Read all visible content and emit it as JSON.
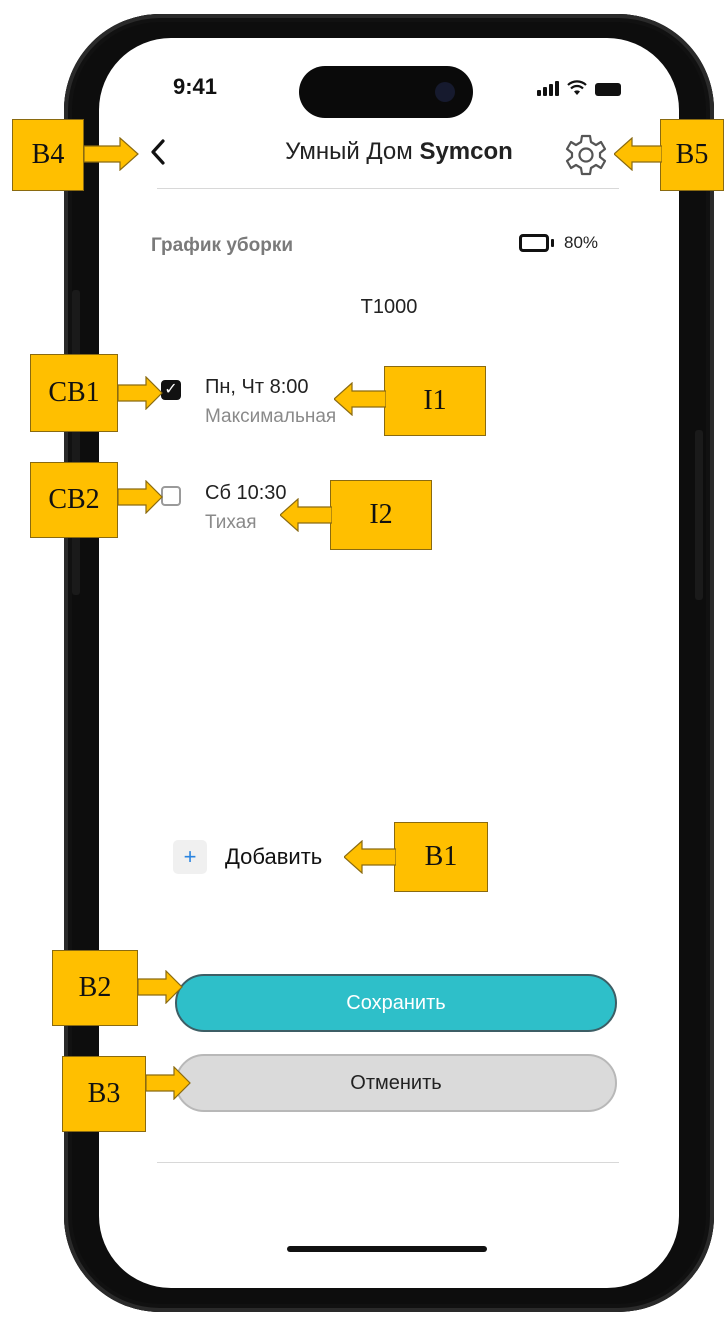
{
  "status_bar": {
    "time": "9:41"
  },
  "nav": {
    "back_icon": "chevron-left-icon",
    "title_regular": "Умный Дом ",
    "title_bold": "Symcon",
    "settings_icon": "gear-icon"
  },
  "section": {
    "title": "График уборки"
  },
  "battery": {
    "icon": "battery-icon",
    "level_text": "80%"
  },
  "device": {
    "name": "T1000"
  },
  "schedules": [
    {
      "time": "Пн, Чт 8:00",
      "mode": "Максимальная",
      "checked": true
    },
    {
      "time": "Сб 10:30",
      "mode": "Тихая",
      "checked": false
    }
  ],
  "add": {
    "icon": "plus-icon",
    "label": "Добавить"
  },
  "buttons": {
    "save": "Сохранить",
    "cancel": "Отменить"
  },
  "callouts": {
    "b4": "B4",
    "b5": "B5",
    "cb1": "CB1",
    "i1": "I1",
    "cb2": "CB2",
    "i2": "I2",
    "b1": "B1",
    "b2": "B2",
    "b3": "B3"
  },
  "colors": {
    "accent": "#2ebfc9",
    "callout": "#ffbf00",
    "add_icon": "#2a84e0"
  }
}
